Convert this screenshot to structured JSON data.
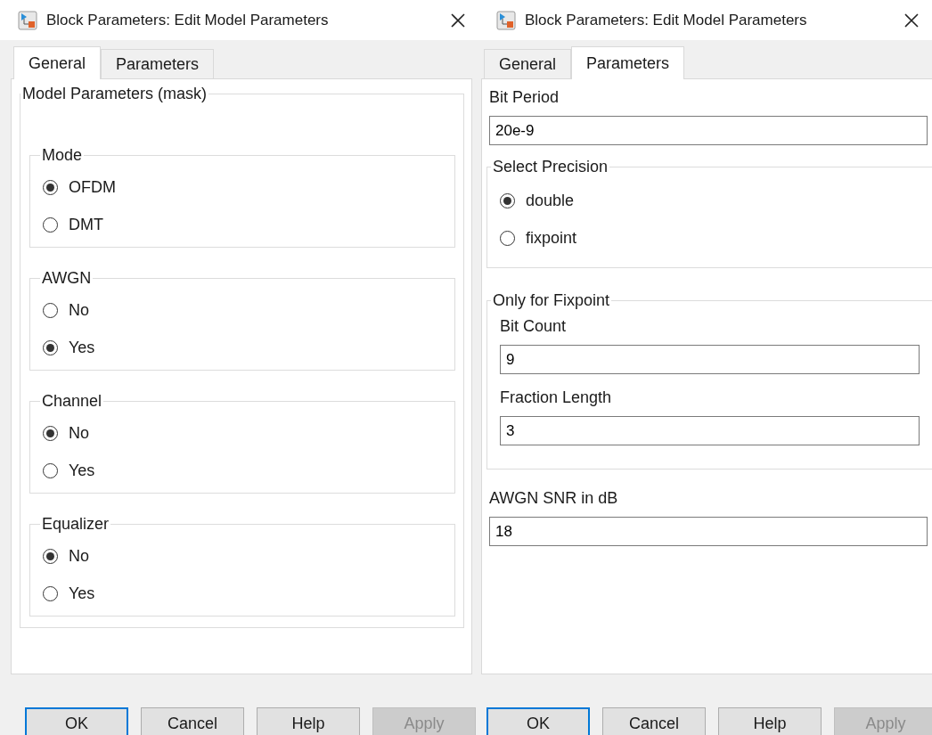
{
  "dialogs": [
    {
      "title": "Block Parameters: Edit Model Parameters",
      "tabs": [
        {
          "label": "General",
          "selected": true
        },
        {
          "label": "Parameters",
          "selected": false
        }
      ],
      "content": [
        {
          "kind": "group",
          "title": "Model Parameters (mask)",
          "items": [
            {
              "kind": "radio_group",
              "title": "Mode",
              "options": [
                {
                  "label": "OFDM",
                  "selected": true
                },
                {
                  "label": "DMT",
                  "selected": false
                }
              ]
            },
            {
              "kind": "radio_group",
              "title": "AWGN",
              "options": [
                {
                  "label": "No",
                  "selected": false
                },
                {
                  "label": "Yes",
                  "selected": true
                }
              ]
            },
            {
              "kind": "radio_group",
              "title": "Channel",
              "options": [
                {
                  "label": "No",
                  "selected": true
                },
                {
                  "label": "Yes",
                  "selected": false
                }
              ]
            },
            {
              "kind": "radio_group",
              "title": "Equalizer",
              "options": [
                {
                  "label": "No",
                  "selected": true
                },
                {
                  "label": "Yes",
                  "selected": false
                }
              ]
            }
          ]
        }
      ],
      "buttons": [
        {
          "label": "OK",
          "default": true,
          "disabled": false
        },
        {
          "label": "Cancel",
          "default": false,
          "disabled": false
        },
        {
          "label": "Help",
          "default": false,
          "disabled": false
        },
        {
          "label": "Apply",
          "default": false,
          "disabled": true
        }
      ]
    },
    {
      "title": "Block Parameters: Edit Model Parameters",
      "tabs": [
        {
          "label": "General",
          "selected": false
        },
        {
          "label": "Parameters",
          "selected": true
        }
      ],
      "content": [
        {
          "kind": "field",
          "label": "Bit Period",
          "value": "20e-9"
        },
        {
          "kind": "radio_group",
          "title": "Select Precision",
          "options": [
            {
              "label": "double",
              "selected": true
            },
            {
              "label": "fixpoint",
              "selected": false
            }
          ]
        },
        {
          "kind": "group",
          "title": "Only for Fixpoint",
          "items": [
            {
              "kind": "field",
              "label": "Bit Count",
              "value": "9"
            },
            {
              "kind": "field",
              "label": "Fraction Length",
              "value": "3"
            }
          ]
        },
        {
          "kind": "field",
          "label": "AWGN SNR in dB",
          "value": "18"
        }
      ],
      "buttons": [
        {
          "label": "OK",
          "default": true,
          "disabled": false
        },
        {
          "label": "Cancel",
          "default": false,
          "disabled": false
        },
        {
          "label": "Help",
          "default": false,
          "disabled": false
        },
        {
          "label": "Apply",
          "default": false,
          "disabled": true
        }
      ]
    }
  ]
}
